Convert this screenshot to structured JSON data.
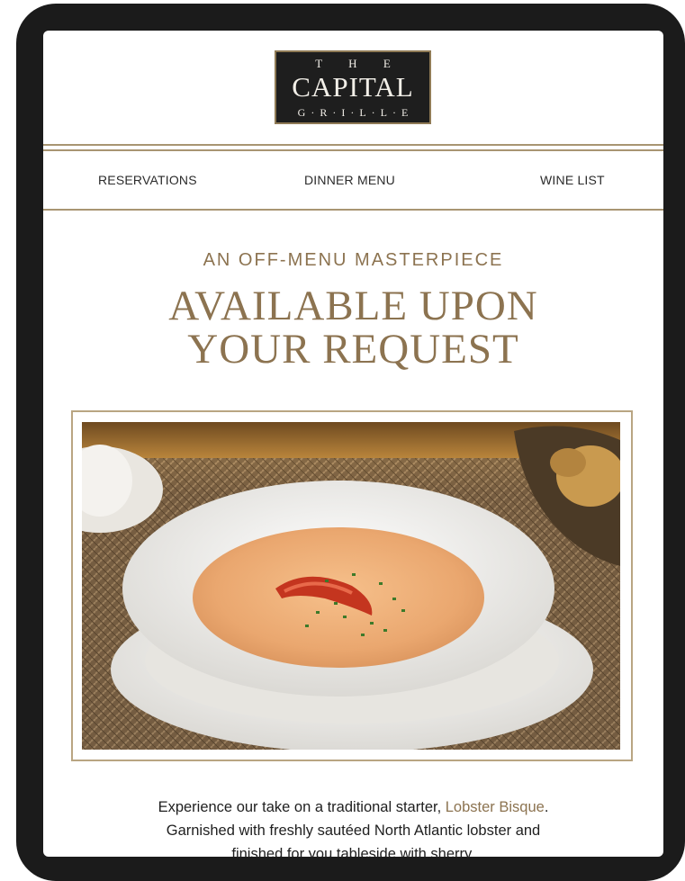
{
  "brand": {
    "logo_top": "T H E",
    "logo_main": "CAPITAL",
    "logo_bottom": "G·R·I·L·L·E",
    "accent_color": "#8c7350"
  },
  "nav": {
    "items": [
      {
        "label": "RESERVATIONS"
      },
      {
        "label": "DINNER MENU"
      },
      {
        "label": "WINE LIST"
      }
    ]
  },
  "hero": {
    "eyebrow": "AN OFF-MENU MASTERPIECE",
    "headline_line1": "AVAILABLE UPON",
    "headline_line2": "YOUR REQUEST",
    "image_icon": "lobster-bisque-photo"
  },
  "body": {
    "line1_prefix": "Experience our take on a traditional starter, ",
    "line1_link": "Lobster Bisque",
    "line1_suffix": ".",
    "line2": "Garnished with freshly sautéed North Atlantic lobster and",
    "line3": "finished for you tableside with sherry."
  }
}
